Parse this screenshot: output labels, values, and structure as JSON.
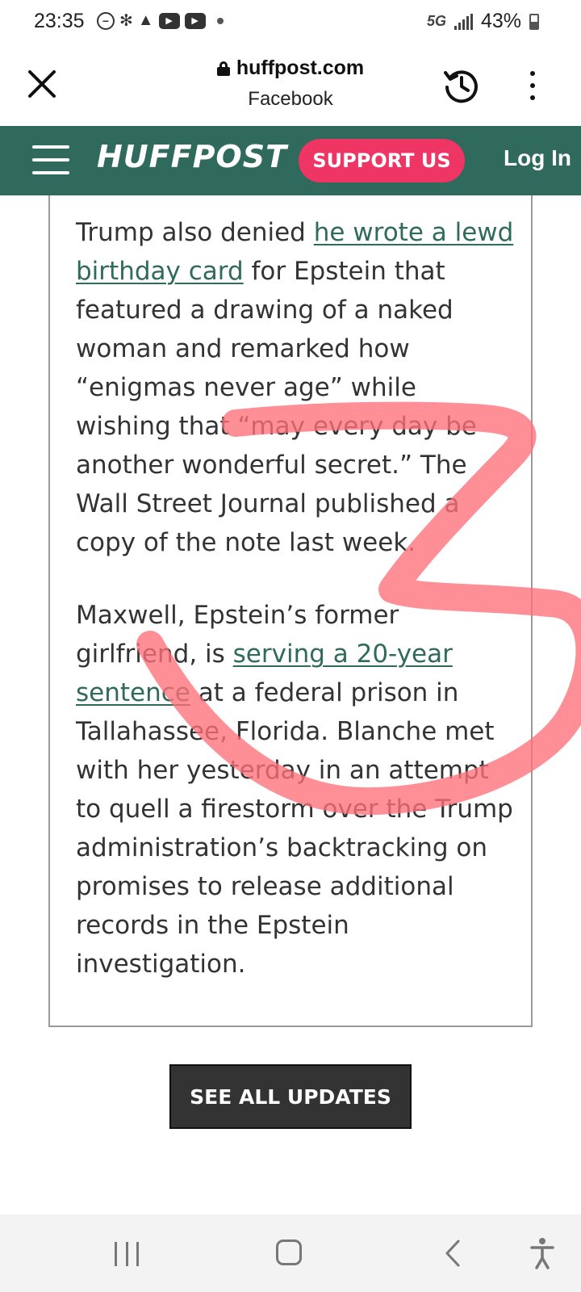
{
  "status_bar": {
    "time": "23:35",
    "network": "5G",
    "battery_text": "43%",
    "battery_level": 0.43,
    "left_icons": [
      "minus-circle-icon",
      "fan-icon",
      "warning-icon",
      "youtube-icon",
      "youtube-icon",
      "dot-icon"
    ]
  },
  "browser": {
    "domain": "huffpost.com",
    "source": "Facebook",
    "icons": [
      "close-icon",
      "lock-icon",
      "history-icon",
      "more-vertical-icon"
    ]
  },
  "site_header": {
    "logo": "HUFFPOST",
    "support_label": "SUPPORT US",
    "login_label": "Log In",
    "background_color": "#2f6a5c",
    "support_color": "#ee3563"
  },
  "article": {
    "p1": {
      "before": "Trump also denied ",
      "link": "he wrote a lewd birthday card",
      "after": " for Epstein that featured a drawing of a naked woman and remarked how “enigmas never age” while wishing that “may every day be another wonderful secret.” The Wall Street Journal published a copy of the note last week."
    },
    "p2": {
      "before": "Maxwell, Epstein’s former girlfriend, is ",
      "link": "serving a 20-year sentence",
      "after": " at a federal prison in Tallahassee, Florida. Blanche met with her yesterday in an attempt to quell a firestorm over the Trump administration’s backtracking on promises to release additional records in the Epstein investigation."
    },
    "link_color": "#2f6a5c"
  },
  "see_all_label": "SEE ALL UPDATES",
  "annotation": {
    "shape": "hand-drawn numeral 3",
    "color": "#ff6f78"
  },
  "nav_bar": {
    "icons": [
      "recents-icon",
      "home-icon",
      "back-icon",
      "accessibility-icon"
    ]
  }
}
